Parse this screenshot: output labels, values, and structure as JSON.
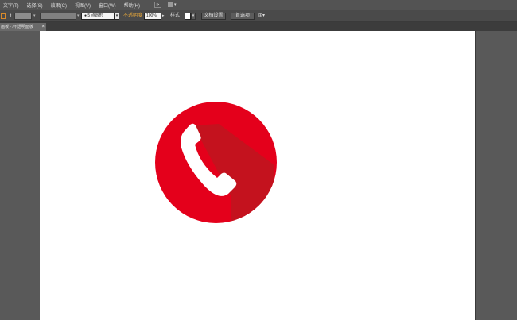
{
  "menubar": {
    "items": [
      "文字(T)",
      "选择(S)",
      "效果(C)",
      "视图(V)",
      "窗口(W)",
      "帮助(H)"
    ],
    "bridge_icon": "bridge-icon",
    "arrange_icon": "arrange-documents-icon"
  },
  "toolbar": {
    "brush_definition": "● 5 点圆形",
    "opacity_label": "不透明度",
    "opacity_value": "100%",
    "style_label": "样式",
    "doc_setup_label": "文档设置",
    "preferences_label": "首选项",
    "arrange_icon": "arrange-icon"
  },
  "document": {
    "tab_label": "画板 - /不透明面板",
    "close_symbol": "×"
  },
  "artwork": {
    "circle_color": "#e4001b",
    "shadow_color": "#c4121e",
    "phone_color": "#ffffff"
  },
  "colors": {
    "menubar_bg": "#535353",
    "toolbar_bg": "#4a4a4a",
    "canvas_bg": "#595959",
    "artboard_bg": "#ffffff",
    "accent": "#e8a83a"
  }
}
